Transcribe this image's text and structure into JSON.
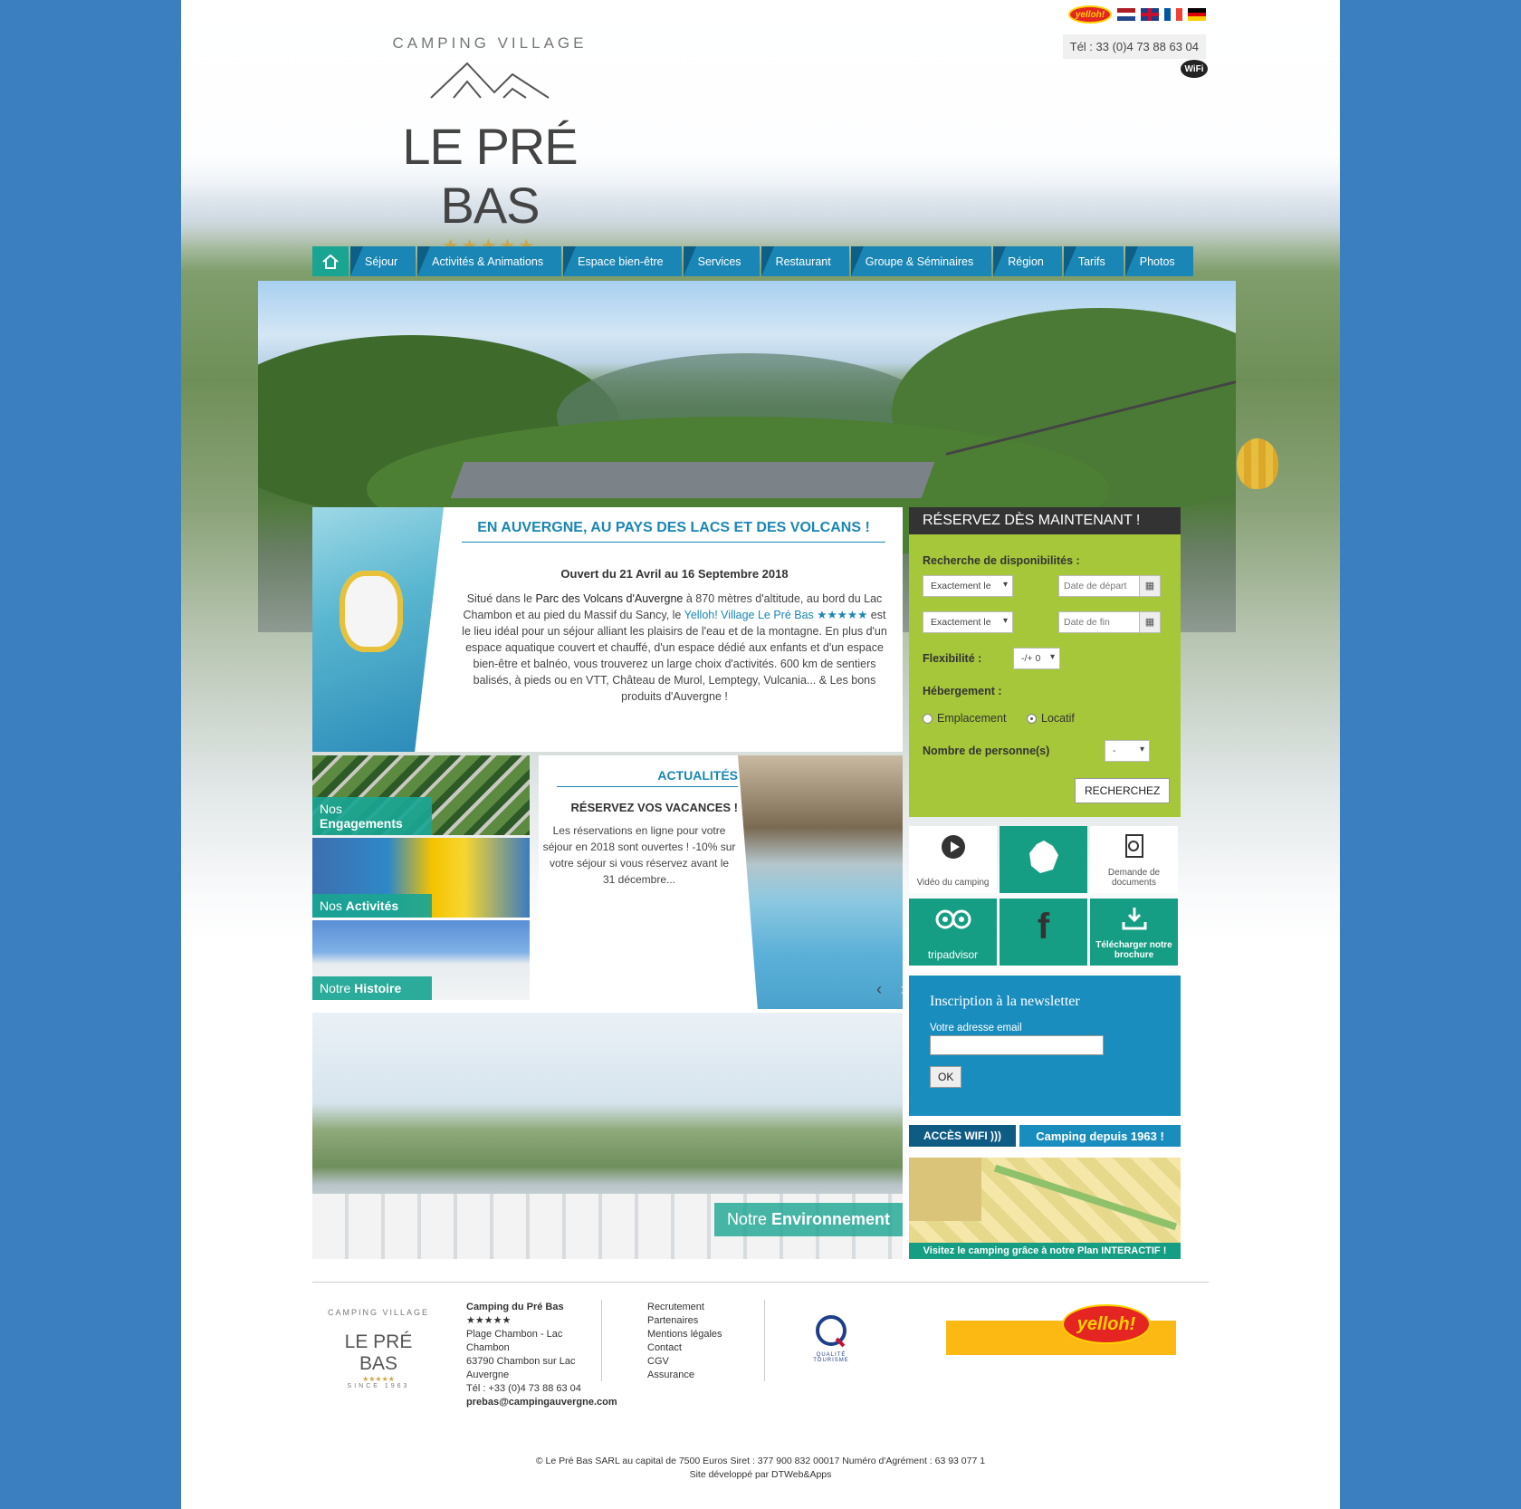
{
  "header": {
    "phone": "Tél : 33 (0)4 73 88 63 04",
    "wifi_label": "WiFi",
    "partner_logo": "yelloh!"
  },
  "logo": {
    "top_text": "CAMPING VILLAGE",
    "name": "LE PRÉ BAS",
    "stars": "★★★★★",
    "since": "SINCE 1963"
  },
  "nav": {
    "home_icon": "home-icon",
    "items": [
      "Séjour",
      "Activités & Animations",
      "Espace bien-être",
      "Services",
      "Restaurant",
      "Groupe & Séminaires",
      "Région",
      "Tarifs",
      "Photos"
    ]
  },
  "intro": {
    "title": "EN AUVERGNE, AU PAYS DES LACS ET DES VOLCANS !",
    "opening": "Ouvert du 21 Avril au 16 Septembre 2018",
    "text_1": "Situé dans le",
    "park": "Parc des Volcans d'Auvergne",
    "text_2": "à 870 mètres d'altitude, au bord du Lac Chambon et au pied du Massif du Sancy, le",
    "village": "Yelloh! Village Le Pré Bas ★★★★★",
    "text_3": "est le lieu idéal pour un séjour alliant les plaisirs de l'eau et de la montagne. En plus d'un espace aquatique couvert et chauffé, d'un espace dédié aux enfants et d'un espace bien-être et balnéo, vous trouverez un large choix d'activités. 600 km de sentiers balisés, à pieds ou en VTT, Château de Murol, Lemptegy, Vulcania... & Les bons produits d'Auvergne !"
  },
  "booking": {
    "title": "RÉSERVEZ DÈS MAINTENANT !",
    "search_label": "Recherche de disponibilités :",
    "exact_1": "Exactement le",
    "start_placeholder": "Date de départ",
    "exact_2": "Exactement le",
    "end_placeholder": "Date de fin",
    "flex_label": "Flexibilité :",
    "flex_value": "-/+ 0",
    "lodging_label": "Hébergement :",
    "option_1": "Emplacement",
    "option_2": "Locatif",
    "selected_option": "Locatif",
    "persons_label": "Nombre de personne(s)",
    "persons_value": "-",
    "search_button": "RECHERCHEZ"
  },
  "tiles": [
    {
      "label": "Vidéo du camping",
      "icon": "play-icon"
    },
    {
      "label": "",
      "icon": "france-map-icon"
    },
    {
      "label": "Demande de documents",
      "icon": "document-icon"
    },
    {
      "label": "tripadvisor",
      "icon": "tripadvisor-icon"
    },
    {
      "label": "",
      "icon": "facebook-icon"
    },
    {
      "label": "Télécharger notre brochure",
      "icon": "download-icon"
    }
  ],
  "side": [
    {
      "pre": "Nos",
      "bold": "Engagements"
    },
    {
      "pre": "Nos",
      "bold": "Activités"
    },
    {
      "pre": "Notre",
      "bold": "Histoire"
    }
  ],
  "news": {
    "title": "ACTUALITÉS",
    "headline": "RÉSERVEZ VOS VACANCES !",
    "text": "Les réservations en ligne pour votre séjour en 2018 sont ouvertes ! -10% sur votre séjour si vous réservez avant le 31 décembre..."
  },
  "environment": {
    "pre": "Notre",
    "bold": "Environnement"
  },
  "newsletter": {
    "title": "Inscription à la newsletter",
    "email_label": "Votre adresse email",
    "ok": "OK"
  },
  "wifi_button": "ACCÈS WIFI",
  "since_button": "Camping depuis 1963 !",
  "plan_caption": "Visitez le camping grâce à notre Plan INTERACTIF !",
  "footer": {
    "address": [
      "Camping du Pré Bas",
      "★★★★★",
      "Plage Chambon - Lac",
      "Chambon",
      "63790 Chambon sur Lac",
      "Auvergne",
      "Tél : +33 (0)4 73 88 63 04"
    ],
    "email": "prebas@campingauvergne.com",
    "links": [
      "Recrutement",
      "Partenaires",
      "Mentions légales",
      "Contact",
      "CGV",
      "Assurance"
    ],
    "quality": "QUALITÉ TOURISME",
    "copyright": "© Le Pré Bas SARL au capital de 7500 Euros Siret : 377 900 832 00017 Numéro d'Agrément : 63 93 077 1",
    "developer": "Site développé par DTWeb&Apps"
  },
  "colors": {
    "primary": "#1a86b6",
    "teal": "#1aa592",
    "green": "#a7c73a",
    "page_bg": "#3c7fc0"
  }
}
